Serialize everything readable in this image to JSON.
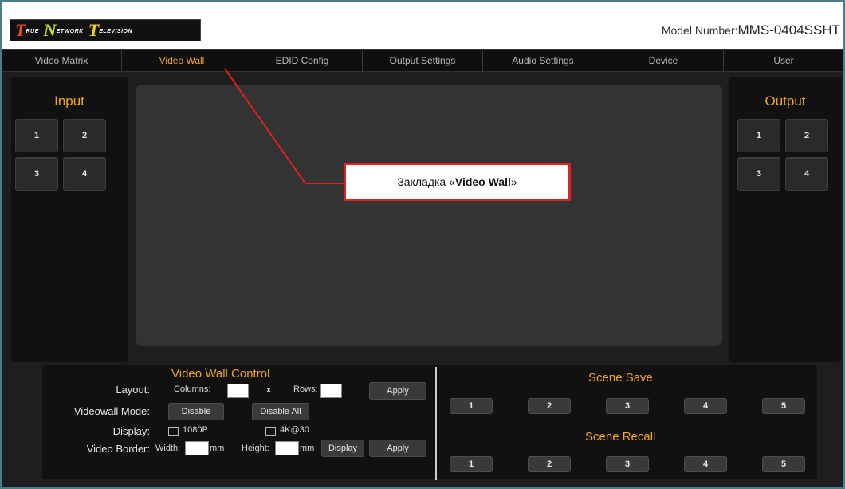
{
  "header": {
    "logo": {
      "word1_initial": "T",
      "word1_rest": "rue",
      "word2_initial": "N",
      "word2_rest": "etwork",
      "word3_initial": "T",
      "word3_rest": "elevision"
    },
    "model_label": "Model Number:",
    "model_value": "MMS-0404SSHT"
  },
  "nav": {
    "tabs": [
      {
        "label": "Video Matrix",
        "active": false
      },
      {
        "label": "Video Wall",
        "active": true
      },
      {
        "label": "EDID Config",
        "active": false
      },
      {
        "label": "Output Settings",
        "active": false
      },
      {
        "label": "Audio Settings",
        "active": false
      },
      {
        "label": "Device",
        "active": false
      },
      {
        "label": "User",
        "active": false
      }
    ]
  },
  "input_panel": {
    "title": "Input",
    "buttons": [
      "1",
      "2",
      "3",
      "4"
    ]
  },
  "output_panel": {
    "title": "Output",
    "buttons": [
      "1",
      "2",
      "3",
      "4"
    ]
  },
  "video_wall_control": {
    "title": "Video Wall Control",
    "layout_label": "Layout:",
    "columns_label": "Columns:",
    "columns_value": "",
    "x_label": "x",
    "rows_label": "Rows:",
    "rows_value": "",
    "apply_label": "Apply",
    "mode_label": "Videowall Mode:",
    "disable_label": "Disable",
    "disable_all_label": "Disable All",
    "display_label": "Display:",
    "option_1080p": "1080P",
    "option_4k30": "4K@30",
    "border_label": "Video Border:",
    "width_label": "Width:",
    "width_value": "",
    "mm_label": "mm",
    "height_label": "Height:",
    "height_value": "",
    "display_button": "Display",
    "apply2_label": "Apply"
  },
  "scene_save": {
    "title": "Scene Save",
    "buttons": [
      "1",
      "2",
      "3",
      "4",
      "5"
    ]
  },
  "scene_recall": {
    "title": "Scene Recall",
    "buttons": [
      "1",
      "2",
      "3",
      "4",
      "5"
    ]
  },
  "annotation": {
    "prefix": "Закладка «",
    "bold": "Video Wall",
    "suffix": "»",
    "color": "#e21f1f"
  },
  "colors": {
    "accent": "#f2a51c",
    "frame": "#4a7d8c",
    "background": "#1e1e1e"
  }
}
